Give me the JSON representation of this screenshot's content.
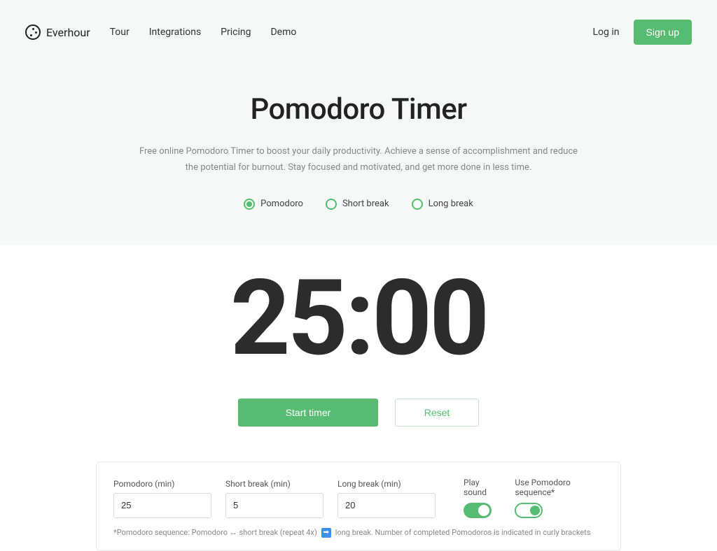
{
  "header": {
    "brand": "Everhour",
    "nav": [
      "Tour",
      "Integrations",
      "Pricing",
      "Demo"
    ],
    "login": "Log in",
    "signup": "Sign up"
  },
  "hero": {
    "title": "Pomodoro Timer",
    "subtitle": "Free online Pomodoro Timer to boost your daily productivity. Achieve a sense of accomplishment and reduce the potential for burnout. Stay focused and motivated, and get more done in less time."
  },
  "modes": {
    "pomodoro": "Pomodoro",
    "short_break": "Short break",
    "long_break": "Long break",
    "selected": "pomodoro"
  },
  "timer": {
    "display": "25:00",
    "start": "Start timer",
    "reset": "Reset"
  },
  "settings": {
    "pomodoro_label": "Pomodoro (min)",
    "pomodoro_value": "25",
    "short_label": "Short break (min)",
    "short_value": "5",
    "long_label": "Long break (min)",
    "long_value": "20",
    "play_sound": "Play sound",
    "use_sequence": "Use Pomodoro sequence*",
    "footnote_pre": "*Pomodoro sequence: Pomodoro ↔ short break (repeat 4x)",
    "footnote_post": "long break. Number of completed Pomodoros is indicated in curly brackets"
  }
}
